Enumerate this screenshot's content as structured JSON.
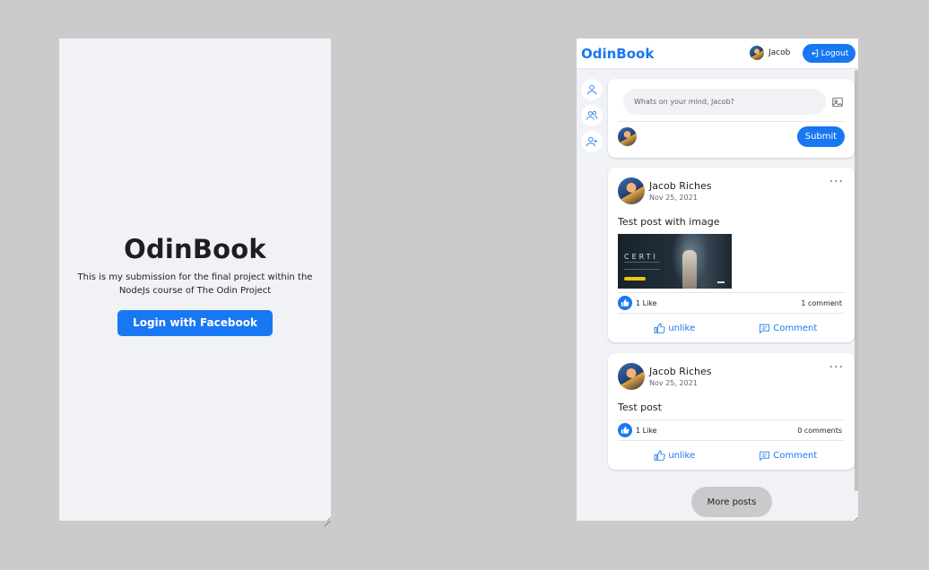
{
  "login": {
    "title": "OdinBook",
    "description": "This is my submission for the final project within the NodeJs course of The Odin Project",
    "button_label": "Login with Facebook"
  },
  "header": {
    "brand": "OdinBook",
    "username": "Jacob",
    "logout_label": "Logout"
  },
  "sidebar": {
    "items": [
      {
        "icon": "profile-icon"
      },
      {
        "icon": "friends-icon"
      },
      {
        "icon": "add-friend-icon"
      }
    ]
  },
  "composer": {
    "placeholder": "Whats on your mind, Jacob?",
    "submit_label": "Submit"
  },
  "posts": [
    {
      "author": "Jacob Riches",
      "date": "Nov 25, 2021",
      "text": "Test post with image",
      "has_image": true,
      "image_text": "CERTI",
      "likes": "1 Like",
      "comments": "1 comment",
      "like_action": "unlike",
      "comment_action": "Comment"
    },
    {
      "author": "Jacob Riches",
      "date": "Nov 25, 2021",
      "text": "Test post",
      "has_image": false,
      "likes": "1 Like",
      "comments": "0 comments",
      "like_action": "unlike",
      "comment_action": "Comment"
    }
  ],
  "more_posts_label": "More posts",
  "colors": {
    "accent": "#1877f2",
    "background": "#f0f2f5",
    "desktop": "#cbcbcb"
  }
}
